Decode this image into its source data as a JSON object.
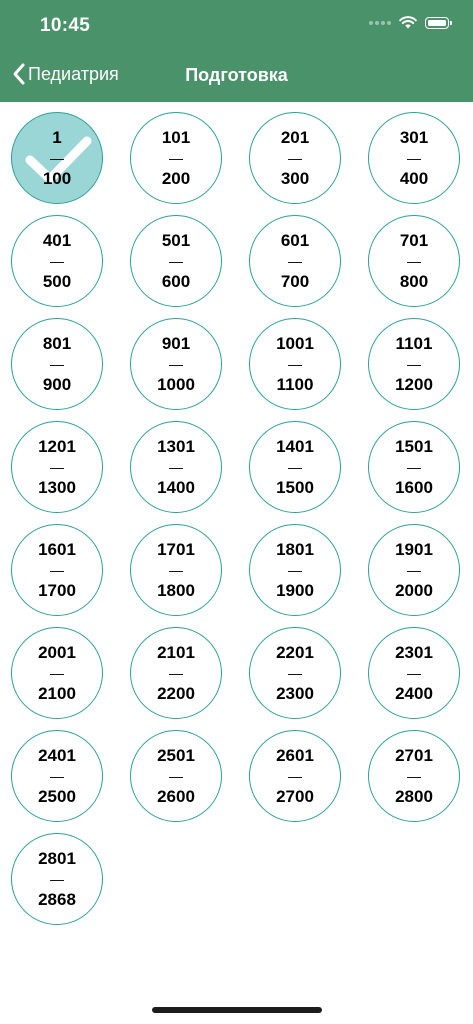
{
  "status_bar": {
    "time": "10:45"
  },
  "nav": {
    "back_label": "Педиатрия",
    "title": "Подготовка"
  },
  "accent_color": "#4a926a",
  "circle_border_color": "#2aa198",
  "completed_fill_color": "#9bd6d6",
  "ranges": [
    {
      "from": "1",
      "sep": "—",
      "to": "100",
      "completed": true
    },
    {
      "from": "101",
      "sep": "—",
      "to": "200",
      "completed": false
    },
    {
      "from": "201",
      "sep": "—",
      "to": "300",
      "completed": false
    },
    {
      "from": "301",
      "sep": "—",
      "to": "400",
      "completed": false
    },
    {
      "from": "401",
      "sep": "—",
      "to": "500",
      "completed": false
    },
    {
      "from": "501",
      "sep": "—",
      "to": "600",
      "completed": false
    },
    {
      "from": "601",
      "sep": "—",
      "to": "700",
      "completed": false
    },
    {
      "from": "701",
      "sep": "—",
      "to": "800",
      "completed": false
    },
    {
      "from": "801",
      "sep": "—",
      "to": "900",
      "completed": false
    },
    {
      "from": "901",
      "sep": "—",
      "to": "1000",
      "completed": false
    },
    {
      "from": "1001",
      "sep": "—",
      "to": "1100",
      "completed": false
    },
    {
      "from": "1101",
      "sep": "—",
      "to": "1200",
      "completed": false
    },
    {
      "from": "1201",
      "sep": "—",
      "to": "1300",
      "completed": false
    },
    {
      "from": "1301",
      "sep": "—",
      "to": "1400",
      "completed": false
    },
    {
      "from": "1401",
      "sep": "—",
      "to": "1500",
      "completed": false
    },
    {
      "from": "1501",
      "sep": "—",
      "to": "1600",
      "completed": false
    },
    {
      "from": "1601",
      "sep": "—",
      "to": "1700",
      "completed": false
    },
    {
      "from": "1701",
      "sep": "—",
      "to": "1800",
      "completed": false
    },
    {
      "from": "1801",
      "sep": "—",
      "to": "1900",
      "completed": false
    },
    {
      "from": "1901",
      "sep": "—",
      "to": "2000",
      "completed": false
    },
    {
      "from": "2001",
      "sep": "—",
      "to": "2100",
      "completed": false
    },
    {
      "from": "2101",
      "sep": "—",
      "to": "2200",
      "completed": false
    },
    {
      "from": "2201",
      "sep": "—",
      "to": "2300",
      "completed": false
    },
    {
      "from": "2301",
      "sep": "—",
      "to": "2400",
      "completed": false
    },
    {
      "from": "2401",
      "sep": "—",
      "to": "2500",
      "completed": false
    },
    {
      "from": "2501",
      "sep": "—",
      "to": "2600",
      "completed": false
    },
    {
      "from": "2601",
      "sep": "—",
      "to": "2700",
      "completed": false
    },
    {
      "from": "2701",
      "sep": "—",
      "to": "2800",
      "completed": false
    },
    {
      "from": "2801",
      "sep": "—",
      "to": "2868",
      "completed": false
    }
  ]
}
